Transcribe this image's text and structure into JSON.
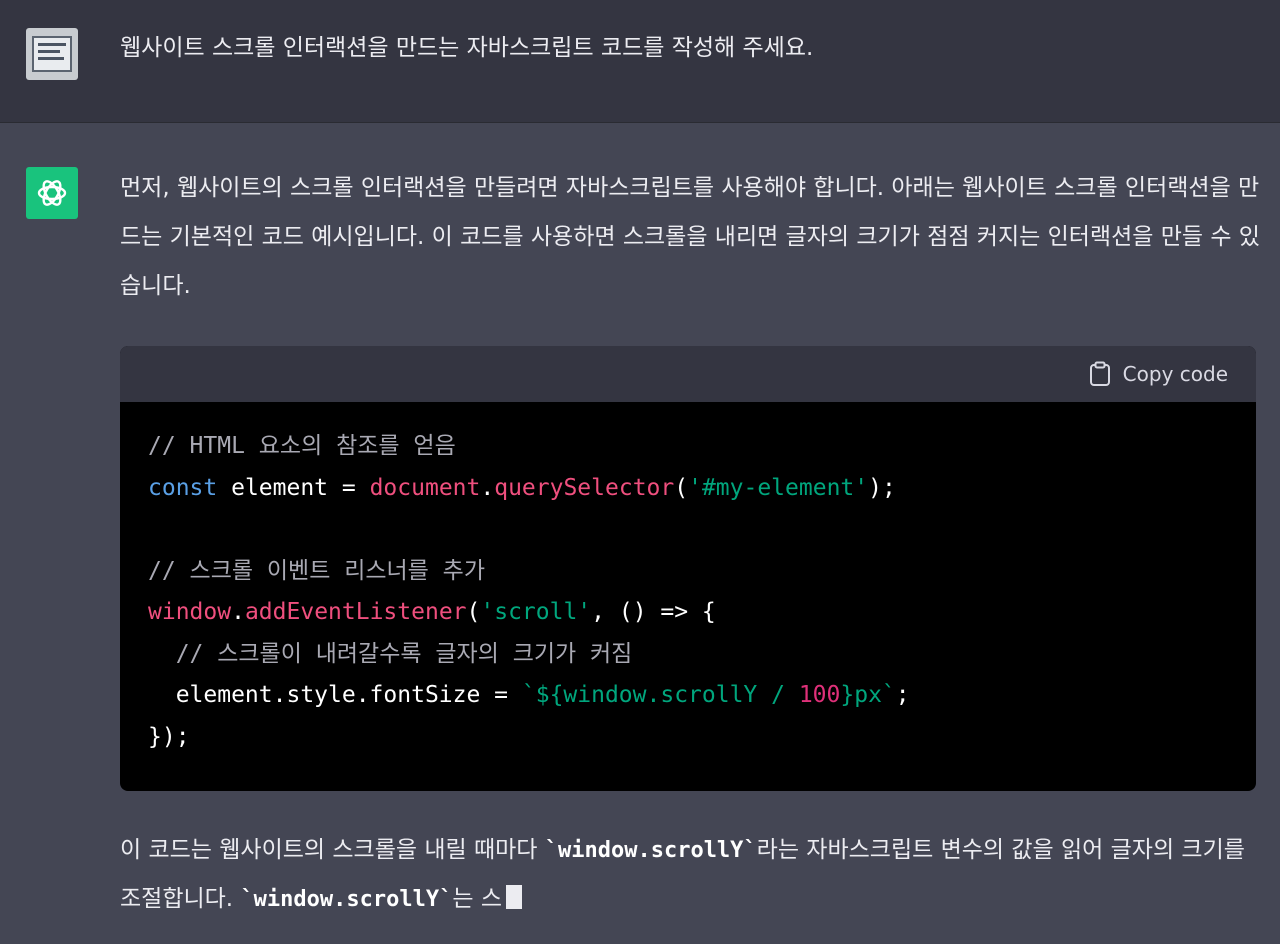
{
  "user_message": {
    "text": "웹사이트 스크롤 인터랙션을 만드는 자바스크립트 코드를 작성해 주세요."
  },
  "assistant_message": {
    "intro": "먼저, 웹사이트의 스크롤 인터랙션을 만들려면 자바스크립트를 사용해야 합니다. 아래는 웹사이트 스크롤 인터랙션을 만드는 기본적인 코드 예시입니다. 이 코드를 사용하면 스크롤을 내리면 글자의 크기가 점점 커지는 인터랙션을 만들 수 있습니다.",
    "copy_code_label": "Copy code",
    "code": {
      "line1_comment": "// HTML 요소의 참조를 얻음",
      "line2_kw": "const",
      "line2_var": " element = ",
      "line2_obj": "document",
      "line2_dot": ".",
      "line2_fn": "querySelector",
      "line2_paren_open": "(",
      "line2_str": "'#my-element'",
      "line2_end": ");",
      "line4_comment": "// 스크롤 이벤트 리스너를 추가",
      "line5_obj": "window",
      "line5_dot": ".",
      "line5_fn": "addEventListener",
      "line5_paren_open": "(",
      "line5_str": "'scroll'",
      "line5_rest": ", () => {",
      "line6_comment": "  // 스크롤이 내려갈수록 글자의 크기가 커짐",
      "line7_lhs": "  element.style.fontSize = ",
      "line7_tpl_start": "`${",
      "line7_tpl_expr": "window.scrollY / ",
      "line7_num": "100",
      "line7_tpl_end": "}px`",
      "line7_semi": ";",
      "line8": "});"
    },
    "outro_part1": "이 코드는 웹사이트의 스크롤을 내릴 때마다 ",
    "outro_code1": "`window.scrollY`",
    "outro_part2": "라는 자바스크립트 변수의 값을 읽어 글자의 크기를 조절합니다. ",
    "outro_code2": "`window.scrollY`",
    "outro_part3": "는 스"
  },
  "colors": {
    "bot_avatar": "#19c37d",
    "user_bg": "#343541",
    "assistant_bg": "#444654"
  }
}
